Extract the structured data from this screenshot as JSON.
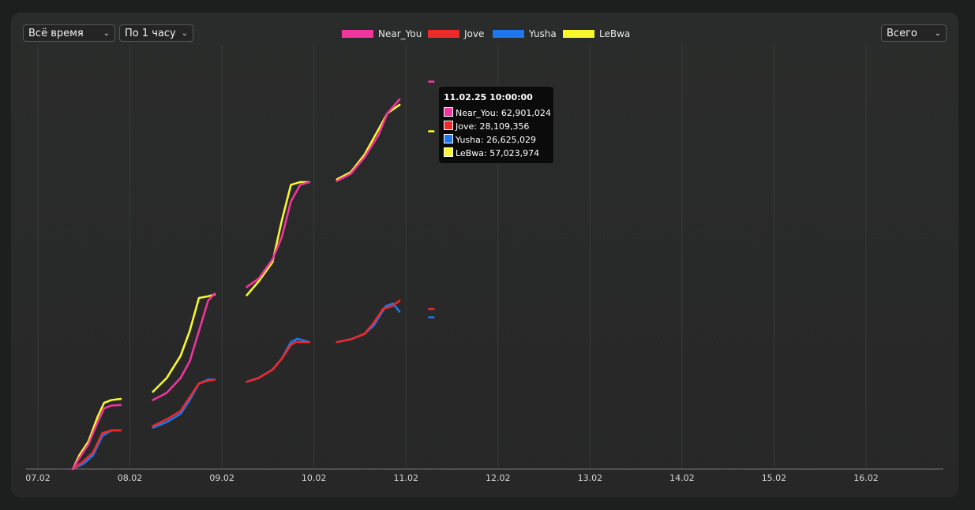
{
  "controls": {
    "period": "Всё время",
    "interval": "По 1 часу",
    "scope": "Всего"
  },
  "chart_data": {
    "type": "line",
    "x_ticks": [
      "07.02",
      "08.02",
      "09.02",
      "10.02",
      "11.02",
      "12.02",
      "13.02",
      "14.02",
      "15.02",
      "16.02"
    ],
    "grid": true,
    "legend": "top-center",
    "series": [
      {
        "name": "Near_You",
        "color": "#f0359e",
        "points": [
          [
            7.38,
            0.0
          ],
          [
            7.45,
            2.0
          ],
          [
            7.55,
            4.5
          ],
          [
            7.65,
            8.5
          ],
          [
            7.72,
            11.0
          ],
          [
            7.8,
            11.5
          ],
          [
            7.9,
            11.6
          ],
          null,
          [
            8.25,
            12.5
          ],
          [
            8.4,
            13.8
          ],
          [
            8.55,
            16.5
          ],
          [
            8.65,
            19.5
          ],
          [
            8.75,
            25.0
          ],
          [
            8.85,
            30.5
          ],
          [
            8.92,
            31.8
          ],
          null,
          [
            9.27,
            33.0
          ],
          [
            9.4,
            34.5
          ],
          [
            9.55,
            38.0
          ],
          [
            9.65,
            42.0
          ],
          [
            9.75,
            48.5
          ],
          [
            9.85,
            51.5
          ],
          [
            9.95,
            52.0
          ],
          null,
          [
            10.25,
            52.2
          ],
          [
            10.4,
            53.5
          ],
          [
            10.55,
            56.5
          ],
          [
            10.7,
            60.5
          ],
          [
            10.8,
            64.5
          ],
          [
            10.93,
            67.0
          ],
          null,
          [
            11.25,
            70.2
          ],
          [
            11.3,
            70.2
          ]
        ]
      },
      {
        "name": "Jove",
        "color": "#ec2a2a",
        "points": [
          [
            7.38,
            0.0
          ],
          [
            7.5,
            1.5
          ],
          [
            7.6,
            3.0
          ],
          [
            7.7,
            6.5
          ],
          [
            7.8,
            7.0
          ],
          [
            7.9,
            7.0
          ],
          null,
          [
            8.25,
            7.8
          ],
          [
            8.4,
            9.0
          ],
          [
            8.55,
            10.5
          ],
          [
            8.65,
            13.0
          ],
          [
            8.75,
            15.5
          ],
          [
            8.85,
            16.0
          ],
          [
            8.92,
            16.2
          ],
          null,
          [
            9.27,
            15.8
          ],
          [
            9.4,
            16.5
          ],
          [
            9.55,
            18.0
          ],
          [
            9.65,
            20.0
          ],
          [
            9.75,
            22.5
          ],
          [
            9.8,
            23.0
          ],
          [
            9.95,
            23.0
          ],
          null,
          [
            10.25,
            23.0
          ],
          [
            10.4,
            23.5
          ],
          [
            10.55,
            24.5
          ],
          [
            10.65,
            26.5
          ],
          [
            10.75,
            29.0
          ],
          [
            10.85,
            29.5
          ],
          [
            10.93,
            30.5
          ],
          null,
          [
            11.25,
            29.0
          ],
          [
            11.3,
            29.0
          ]
        ]
      },
      {
        "name": "Yusha",
        "color": "#1e77ee",
        "points": [
          [
            7.38,
            0.0
          ],
          [
            7.5,
            1.0
          ],
          [
            7.6,
            2.5
          ],
          [
            7.7,
            6.0
          ],
          [
            7.8,
            7.0
          ],
          [
            7.9,
            7.0
          ],
          null,
          [
            8.25,
            7.5
          ],
          [
            8.4,
            8.5
          ],
          [
            8.55,
            10.0
          ],
          [
            8.65,
            12.5
          ],
          [
            8.75,
            15.5
          ],
          [
            8.85,
            16.2
          ],
          [
            8.92,
            16.2
          ],
          null,
          [
            9.27,
            15.8
          ],
          [
            9.4,
            16.5
          ],
          [
            9.55,
            18.0
          ],
          [
            9.65,
            20.0
          ],
          [
            9.75,
            23.0
          ],
          [
            9.82,
            23.6
          ],
          [
            9.95,
            23.0
          ],
          null,
          [
            10.25,
            23.0
          ],
          [
            10.4,
            23.5
          ],
          [
            10.55,
            24.5
          ],
          [
            10.65,
            26.0
          ],
          [
            10.78,
            29.5
          ],
          [
            10.86,
            30.0
          ],
          [
            10.93,
            28.5
          ],
          null,
          [
            11.25,
            27.5
          ],
          [
            11.3,
            27.5
          ]
        ]
      },
      {
        "name": "LeBwa",
        "color": "#f7f72e",
        "points": [
          [
            7.38,
            0.0
          ],
          [
            7.45,
            2.5
          ],
          [
            7.55,
            5.0
          ],
          [
            7.65,
            9.5
          ],
          [
            7.72,
            12.0
          ],
          [
            7.8,
            12.5
          ],
          [
            7.9,
            12.7
          ],
          null,
          [
            8.25,
            14.0
          ],
          [
            8.4,
            16.5
          ],
          [
            8.55,
            20.5
          ],
          [
            8.65,
            25.0
          ],
          [
            8.75,
            31.0
          ],
          [
            8.85,
            31.3
          ],
          [
            8.92,
            31.6
          ],
          null,
          [
            9.27,
            31.5
          ],
          [
            9.4,
            34.0
          ],
          [
            9.55,
            37.5
          ],
          [
            9.65,
            45.0
          ],
          [
            9.75,
            51.5
          ],
          [
            9.85,
            52.0
          ],
          [
            9.95,
            52.0
          ],
          null,
          [
            10.25,
            52.5
          ],
          [
            10.4,
            53.8
          ],
          [
            10.55,
            57.0
          ],
          [
            10.7,
            61.5
          ],
          [
            10.8,
            64.5
          ],
          [
            10.93,
            66.0
          ],
          null,
          [
            11.25,
            61.2
          ],
          [
            11.3,
            61.2
          ]
        ]
      }
    ],
    "tooltip": {
      "title": "11.02.25 10:00:00",
      "rows": [
        {
          "label": "Near_You: 62,901,024",
          "color": "#f0359e"
        },
        {
          "label": "Jove: 28,109,356",
          "color": "#ec2a2a"
        },
        {
          "label": "Yusha: 26,625,029",
          "color": "#1e77ee"
        },
        {
          "label": "LeBwa: 57,023,974",
          "color": "#f7f72e"
        }
      ]
    }
  }
}
